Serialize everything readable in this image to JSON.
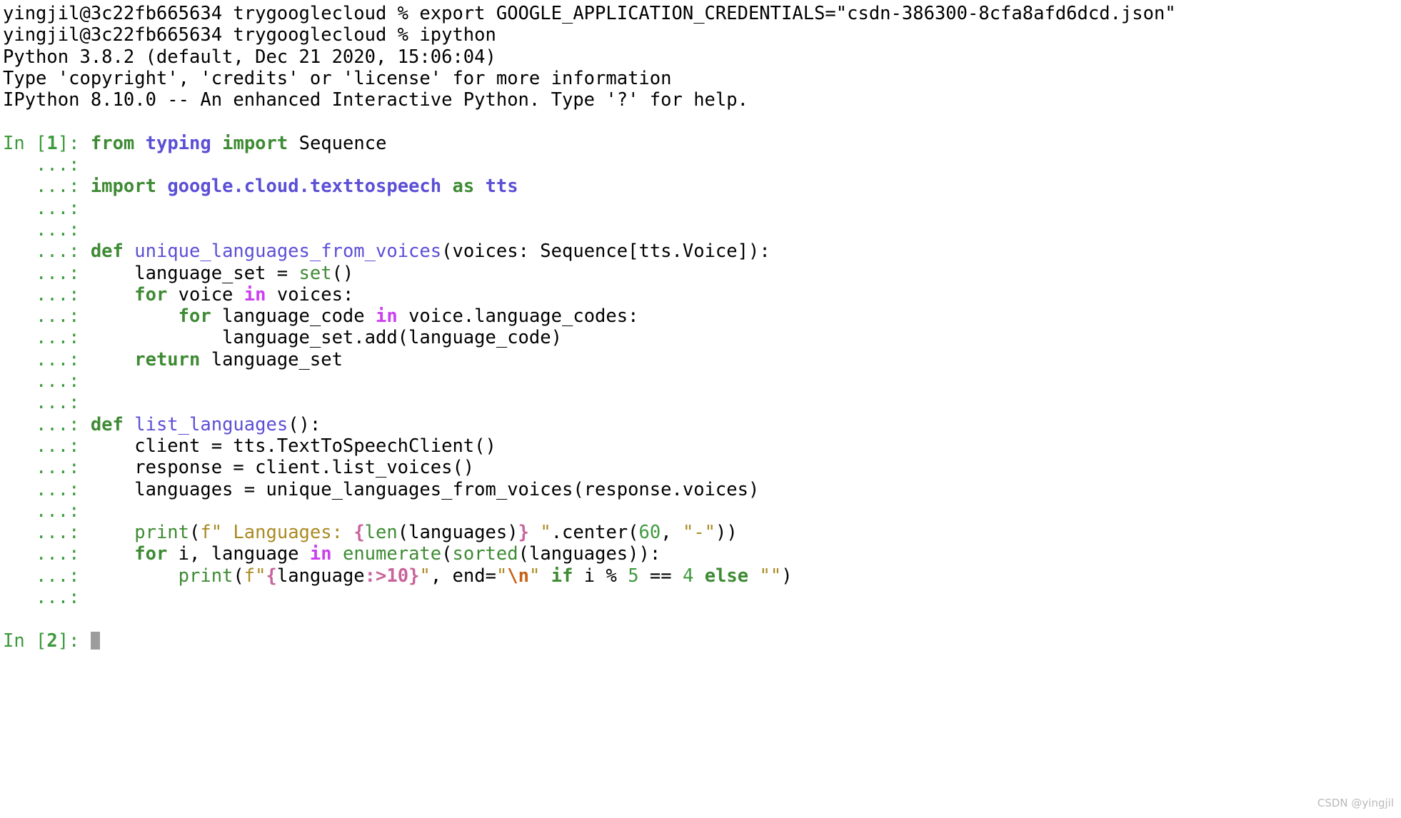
{
  "terminal": {
    "shell_prompt_user": "yingjil@3c22fb665634",
    "shell_prompt_dir": "trygooglecloud",
    "shell_prompt_symbol": "%",
    "colors": {
      "background": "#ffffff",
      "foreground": "#000000",
      "prompt_green": "#3E9A3E",
      "keyword_green": "#3E8B34",
      "operator_magenta": "#CB3FF0",
      "namespace_blue": "#5B4FD6",
      "string_olive": "#AA8A22",
      "fstring_brace_pink": "#C9639B",
      "escape_orange": "#C96116",
      "cursor_grey": "#9c9c9c",
      "watermark_grey": "#b9b9b9"
    },
    "header_lines": [
      "yingjil@3c22fb665634 trygooglecloud % export GOOGLE_APPLICATION_CREDENTIALS=\"csdn-386300-8cfa8afd6dcd.json\"",
      "yingjil@3c22fb665634 trygooglecloud % ipython",
      "Python 3.8.2 (default, Dec 21 2020, 15:06:04)",
      "Type 'copyright', 'credits' or 'license' for more information",
      "IPython 8.10.0 -- An enhanced Interactive Python. Type '?' for help."
    ],
    "env_var_name": "GOOGLE_APPLICATION_CREDENTIALS",
    "env_var_value": "csdn-386300-8cfa8afd6dcd.json",
    "export_command": "export",
    "ipython_command": "ipython",
    "python_version_line": "Python 3.8.2 (default, Dec 21 2020, 15:06:04)",
    "copyright_line": "Type 'copyright', 'credits' or 'license' for more information",
    "ipython_version_line": "IPython 8.10.0 -- An enhanced Interactive Python. Type '?' for help.",
    "prompt_in_1": "In [1]:",
    "prompt_in_1_label": "In [",
    "prompt_in_1_num": "1",
    "prompt_in_1_tail": "]:",
    "prompt_in_2_label": "In [",
    "prompt_in_2_num": "2",
    "prompt_in_2_tail": "]:",
    "continuation": "   ...:",
    "code_lines": [
      "from typing import Sequence",
      "",
      "import google.cloud.texttospeech as tts",
      "",
      "",
      "def unique_languages_from_voices(voices: Sequence[tts.Voice]):",
      "    language_set = set()",
      "    for voice in voices:",
      "        for language_code in voice.language_codes:",
      "            language_set.add(language_code)",
      "    return language_set",
      "",
      "",
      "def list_languages():",
      "    client = tts.TextToSpeechClient()",
      "    response = client.list_voices()",
      "    languages = unique_languages_from_voices(response.voices)",
      "",
      "    print(f\" Languages: {len(languages)} \".center(60, \"-\"))",
      "    for i, language in enumerate(sorted(languages)):",
      "        print(f\"{language:>10}\", end=\"\\n\" if i % 5 == 4 else \"\")",
      ""
    ]
  },
  "watermark": "CSDN @yingjil"
}
